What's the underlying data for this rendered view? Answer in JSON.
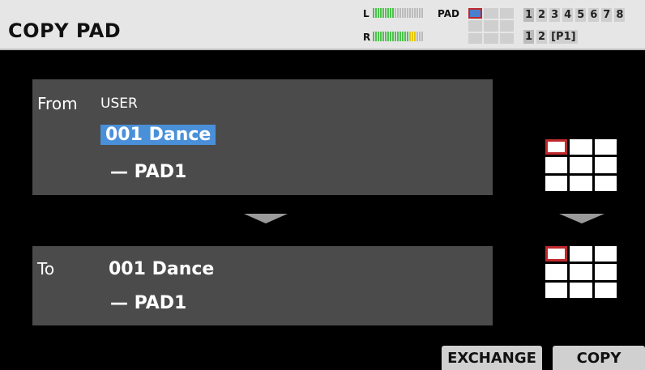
{
  "header": {
    "title": "COPY PAD",
    "meter_left_label": "L",
    "meter_right_label": "R",
    "pad_label": "PAD",
    "kit_numbers": [
      "1",
      "2",
      "3",
      "4",
      "5",
      "6",
      "7",
      "8"
    ],
    "bank_numbers": [
      "1",
      "2"
    ],
    "page_label": "[P1]"
  },
  "from": {
    "label": "From",
    "bank": "USER",
    "kit": "001 Dance",
    "pad": "— PAD1"
  },
  "to": {
    "label": "To",
    "kit": "001 Dance",
    "pad": "— PAD1"
  },
  "softkeys": {
    "exchange": "EXCHANGE",
    "copy": "COPY"
  },
  "colors": {
    "selection_bg": "#4a90d9",
    "pad_select_border": "#c0282c",
    "panel_bg": "#4b4b4b",
    "title_bar_bg": "#e6e6e6"
  }
}
